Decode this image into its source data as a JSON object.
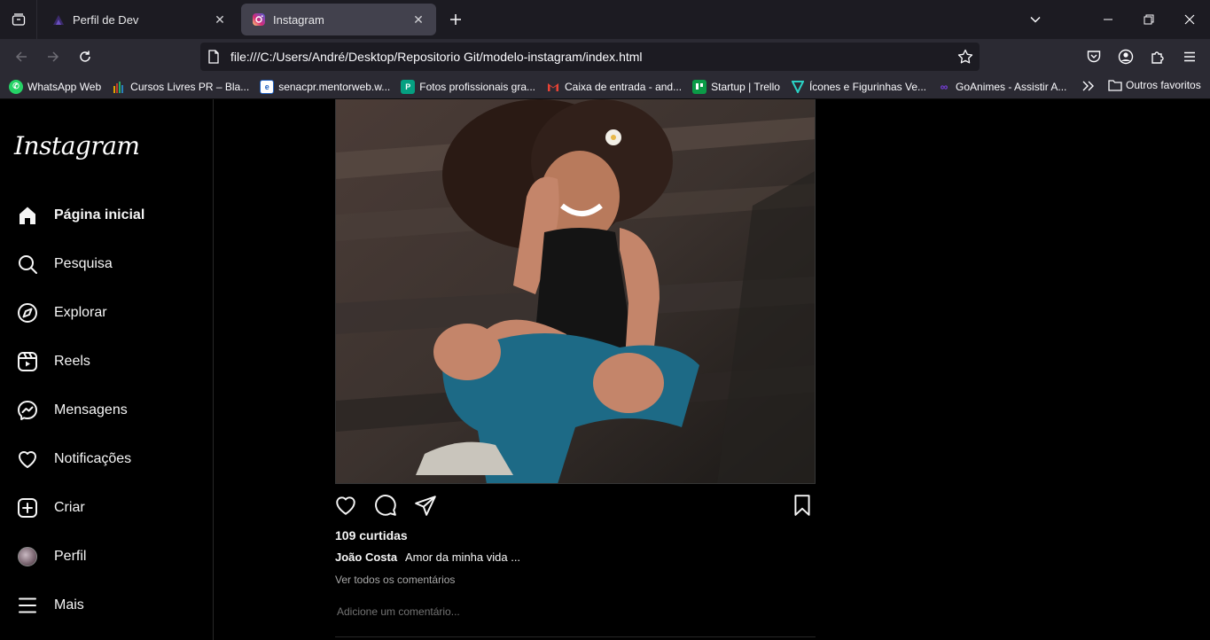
{
  "browser": {
    "tabs": [
      {
        "title": "Perfil de Dev",
        "active": false
      },
      {
        "title": "Instagram",
        "active": true
      }
    ],
    "url": "file:///C:/Users/André/Desktop/Repositorio Git/modelo-instagram/index.html",
    "bookmarks": [
      {
        "label": "WhatsApp Web",
        "icon": "whatsapp-icon",
        "color": "#25d366"
      },
      {
        "label": "Cursos Livres PR – Bla...",
        "icon": "bar-chart-icon",
        "color": "#e0a100"
      },
      {
        "label": "senacpr.mentorweb.w...",
        "icon": "e-icon",
        "color": "#1f5fbf"
      },
      {
        "label": "Fotos profissionais gra...",
        "icon": "pexels-icon",
        "color": "#05a081"
      },
      {
        "label": "Caixa de entrada - and...",
        "icon": "gmail-icon",
        "color": "#ea4335"
      },
      {
        "label": "Startup | Trello",
        "icon": "trello-icon",
        "color": "#0b9b47"
      },
      {
        "label": "Ícones e Figurinhas Ve...",
        "icon": "flaticon-icon",
        "color": "#2bd1c4"
      },
      {
        "label": "GoAnimes - Assistir A...",
        "icon": "goanimes-icon",
        "color": "#7b3fe4"
      }
    ],
    "other_bookmarks": "Outros favoritos"
  },
  "sidebar": {
    "logo": "Instagram",
    "items": [
      {
        "label": "Página inicial",
        "icon": "home-icon"
      },
      {
        "label": "Pesquisa",
        "icon": "search-icon"
      },
      {
        "label": "Explorar",
        "icon": "compass-icon"
      },
      {
        "label": "Reels",
        "icon": "reels-icon"
      },
      {
        "label": "Mensagens",
        "icon": "messenger-icon"
      },
      {
        "label": "Notificações",
        "icon": "heart-icon"
      },
      {
        "label": "Criar",
        "icon": "plus-square-icon"
      },
      {
        "label": "Perfil",
        "icon": "avatar"
      },
      {
        "label": "Mais",
        "icon": "menu-icon"
      }
    ]
  },
  "post": {
    "likes": "109 curtidas",
    "username": "João Costa",
    "caption": "Amor da minha vida ...",
    "view_comments": "Ver todos os comentários",
    "comment_placeholder": "Adicione um comentário..."
  }
}
